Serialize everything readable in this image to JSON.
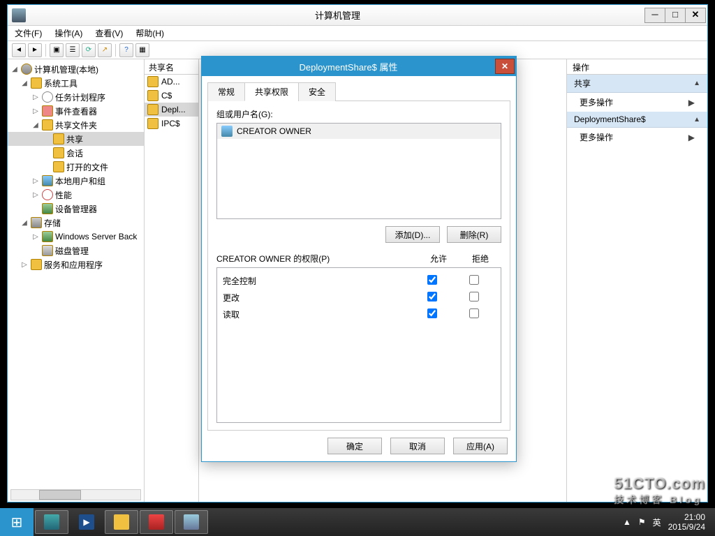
{
  "window": {
    "title": "计算机管理",
    "win_btns": {
      "min": "─",
      "max": "□",
      "close": "✕"
    }
  },
  "menu": {
    "file": "文件(F)",
    "action": "操作(A)",
    "view": "查看(V)",
    "help": "帮助(H)"
  },
  "tree": {
    "root": "计算机管理(本地)",
    "sys_tools": "系统工具",
    "task_sched": "任务计划程序",
    "event_viewer": "事件查看器",
    "shared_folders": "共享文件夹",
    "shares": "共享",
    "sessions": "会话",
    "open_files": "打开的文件",
    "local_users": "本地用户和组",
    "perf": "性能",
    "dev_mgr": "设备管理器",
    "storage": "存储",
    "wsb": "Windows Server Back",
    "disk_mgmt": "磁盘管理",
    "services_apps": "服务和应用程序"
  },
  "list": {
    "header": "共享名",
    "items": [
      "AD...",
      "C$",
      "Depl...",
      "IPC$"
    ]
  },
  "actions": {
    "header": "操作",
    "section1": "共享",
    "more1": "更多操作",
    "section2": "DeploymentShare$",
    "more2": "更多操作"
  },
  "dialog": {
    "title": "DeploymentShare$ 属性",
    "tabs": {
      "general": "常规",
      "share_perm": "共享权限",
      "security": "安全"
    },
    "group_label": "组或用户名(G):",
    "user": "CREATOR OWNER",
    "add": "添加(D)...",
    "remove": "删除(R)",
    "perm_label": "CREATOR OWNER 的权限(P)",
    "allow": "允许",
    "deny": "拒绝",
    "rows": {
      "full": {
        "label": "完全控制",
        "allow": true,
        "deny": false
      },
      "change": {
        "label": "更改",
        "allow": true,
        "deny": false
      },
      "read": {
        "label": "读取",
        "allow": true,
        "deny": false
      }
    },
    "ok": "确定",
    "cancel": "取消",
    "apply": "应用(A)"
  },
  "taskbar": {
    "time": "21:00",
    "date": "2015/9/24",
    "ime": "英",
    "tray_up": "▲"
  },
  "watermark": {
    "site": "51CTO.com",
    "sub": "技术博客 Blog"
  }
}
